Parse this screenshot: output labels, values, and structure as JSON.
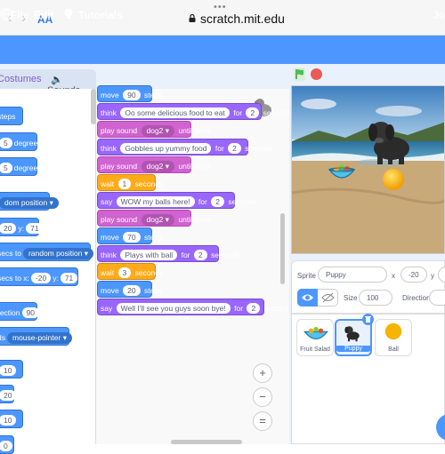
{
  "browser": {
    "dots": "•••",
    "back_glyph": "‹",
    "forward_glyph": "›",
    "text_size_label": "AA",
    "url": "scratch.mit.edu",
    "lock_icon": "lock-icon"
  },
  "menu": {
    "file": "File",
    "edit": "Edit",
    "tutorials": "Tutorials",
    "join": "Jo"
  },
  "tabs": {
    "costumes": "Costumes",
    "sounds": "Sounds"
  },
  "palette": {
    "steps": "steps",
    "degrees1_val": "5",
    "degrees1": "degrees",
    "degrees2_val": "5",
    "degrees2": "degrees",
    "goto_dd": "dom position",
    "xy_x": "20",
    "xy_y_label": "y:",
    "xy_y": "71",
    "glide1_label": "secs to",
    "glide1_dd": "random position",
    "glide2_label": "secs to x:",
    "glide2_x": "-20",
    "glide2_y_label": "y:",
    "glide2_y": "71",
    "direction_label": "rection",
    "direction_val": "90",
    "towards_label": "ds",
    "towards_dd": "mouse-pointer",
    "by10a": "10",
    "val20": "20",
    "by10b": "10",
    "val0": "0"
  },
  "script": [
    {
      "kind": "motion",
      "parts": [
        "move",
        "90",
        "steps"
      ]
    },
    {
      "kind": "looks",
      "parts": [
        "think",
        "Oo some delicious food to eat",
        "for",
        "2",
        "seconds"
      ]
    },
    {
      "kind": "sound",
      "parts": [
        "play sound",
        "dog2 ▾",
        "until done"
      ]
    },
    {
      "kind": "looks",
      "parts": [
        "think",
        "Gobbles up yummy food",
        "for",
        "2",
        "seconds"
      ]
    },
    {
      "kind": "sound",
      "parts": [
        "play sound",
        "dog2 ▾",
        "until done"
      ]
    },
    {
      "kind": "control",
      "parts": [
        "wait",
        "1",
        "seconds"
      ]
    },
    {
      "kind": "looks",
      "parts": [
        "say",
        "WOW my balls here!",
        "for",
        "2",
        "seconds"
      ]
    },
    {
      "kind": "sound",
      "parts": [
        "play sound",
        "dog2 ▾",
        "until done"
      ]
    },
    {
      "kind": "motion",
      "parts": [
        "move",
        "70",
        "steps"
      ]
    },
    {
      "kind": "looks",
      "parts": [
        "think",
        "Plays with ball",
        "for",
        "2",
        "seconds"
      ]
    },
    {
      "kind": "control",
      "parts": [
        "wait",
        "3",
        "seconds"
      ]
    },
    {
      "kind": "motion",
      "parts": [
        "move",
        "20",
        "steps"
      ]
    },
    {
      "kind": "looks",
      "parts": [
        "say",
        "Well I'll see you guys soon bye!",
        "for",
        "2",
        "seconds"
      ]
    }
  ],
  "zoom": {
    "zoom_in": "+",
    "zoom_out": "−",
    "reset": "="
  },
  "sprite_info": {
    "sprite_label": "Sprite",
    "sprite_name": "Puppy",
    "x_label": "x",
    "x_value": "-20",
    "y_label": "y",
    "size_label": "Size",
    "size_value": "100",
    "direction_label": "Direction"
  },
  "sprites": [
    {
      "name": "Fruit Salad",
      "selected": false
    },
    {
      "name": "Puppy",
      "selected": true
    },
    {
      "name": "Ball",
      "selected": false
    }
  ],
  "colors": {
    "menu_blue": "#4c97ff",
    "motion": "#4c97ff",
    "looks": "#9966ff",
    "sound": "#cf63cf",
    "control": "#ffab19",
    "stop_red": "#ec5959",
    "flag_green": "#4cbf56"
  }
}
